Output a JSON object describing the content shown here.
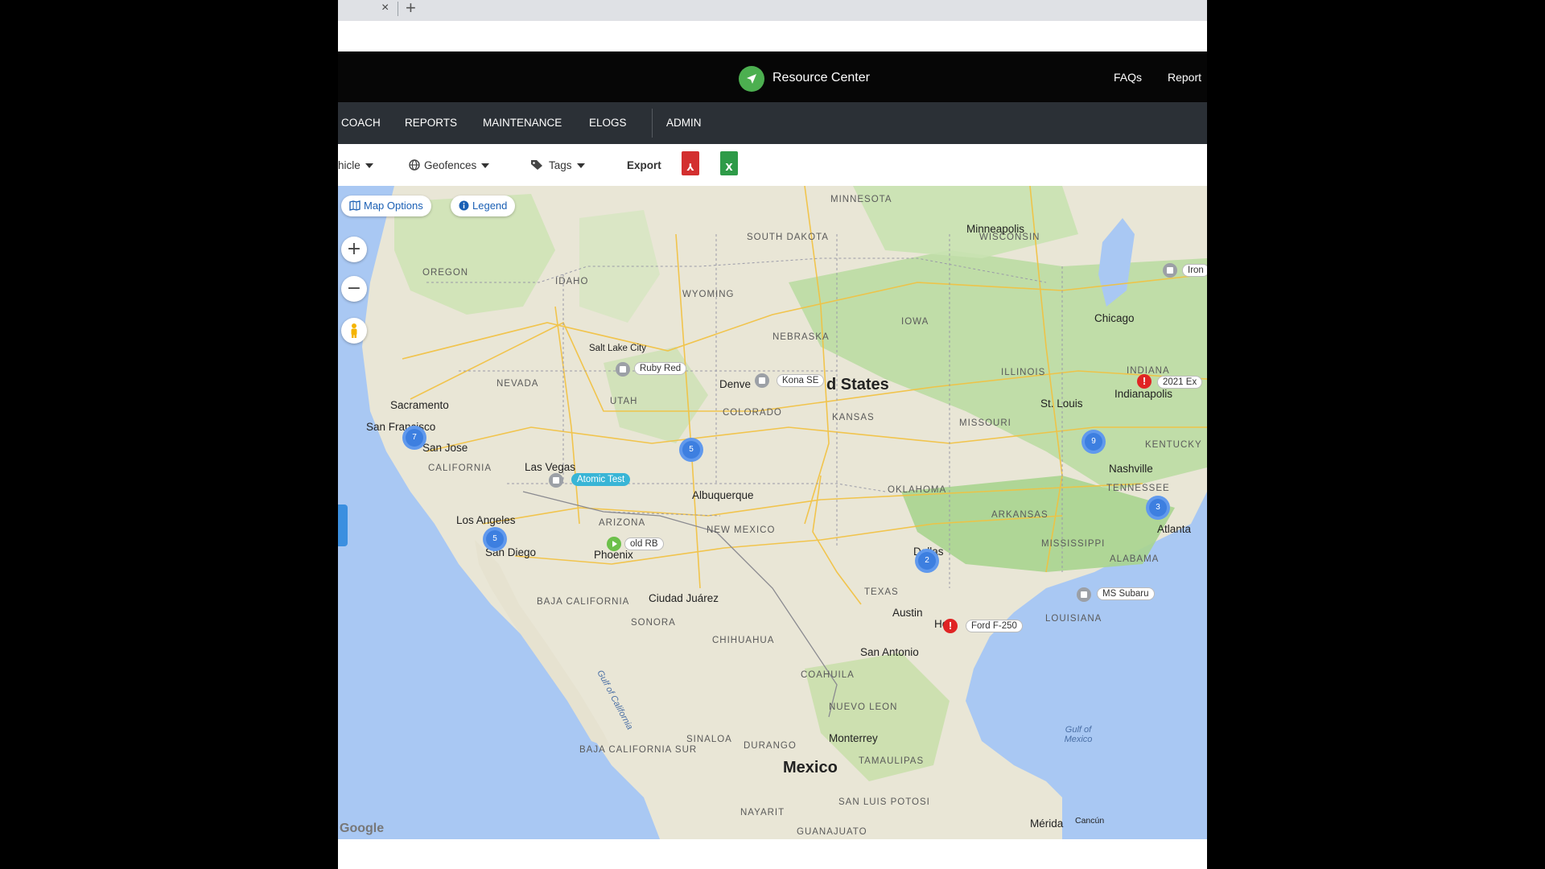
{
  "browser": {
    "close_glyph": "×",
    "new_tab_glyph": "+"
  },
  "header": {
    "app_name": "Resource Center",
    "links": [
      "FAQs",
      "Report"
    ]
  },
  "nav": {
    "items": [
      "COACH",
      "REPORTS",
      "MAINTENANCE",
      "ELOGS",
      "ADMIN"
    ]
  },
  "toolbar": {
    "vehicle_label": "hicle",
    "geofences_label": "Geofences",
    "tags_label": "Tags",
    "export_label": "Export",
    "pdf_glyph": "⅄",
    "excel_glyph": "X"
  },
  "map": {
    "options_label": "Map Options",
    "legend_label": "Legend",
    "zoom_in": "+",
    "zoom_out": "−",
    "attribution": "Google",
    "states": [
      "MINNESOTA",
      "SOUTH DAKOTA",
      "WISCONSIN",
      "OREGON",
      "IDAHO",
      "WYOMING",
      "IOWA",
      "NEBRASKA",
      "NEVADA",
      "UTAH",
      "COLORADO",
      "ILLINOIS",
      "INDIANA",
      "MISSOURI",
      "KANSAS",
      "CALIFORNIA",
      "KENTUCKY",
      "TENNESSEE",
      "ARIZONA",
      "NEW MEXICO",
      "OKLAHOMA",
      "ARKANSAS",
      "MISSISSIPPI",
      "ALABAMA",
      "TEXAS",
      "LOUISIANA",
      "BAJA CALIFORNIA",
      "SONORA",
      "CHIHUAHUA",
      "COAHUILA",
      "NUEVO LEON",
      "SINALOA",
      "DURANGO",
      "TAMAULIPAS",
      "BAJA CALIFORNIA SUR",
      "SAN LUIS POTOSI",
      "NAYARIT",
      "GUANAJUATO"
    ],
    "cities": [
      "Minneapolis",
      "Chicago",
      "Salt Lake City",
      "Denve",
      "St. Louis",
      "Indianapolis",
      "Sacramento",
      "San Francisco",
      "San Jose",
      "Las Vegas",
      "Nashville",
      "Albuquerque",
      "Los Angeles",
      "San Diego",
      "Phoenix",
      "Atlanta",
      "Dallas",
      "Ciudad Juárez",
      "Austin",
      "San Antonio",
      "Monterrey",
      "Mérida",
      "Cancún",
      "Ho"
    ],
    "country_labels": [
      "d States",
      "Mexico"
    ],
    "water_labels": [
      "Gulf of California",
      "Gulf of Mexico"
    ],
    "clusters": [
      "7",
      "5",
      "5",
      "9",
      "3",
      "2"
    ],
    "vehicles": [
      {
        "name": "Ruby Red",
        "status": "idle"
      },
      {
        "name": "Kona SE",
        "status": "idle"
      },
      {
        "name": "Atomic Test",
        "status": "idle",
        "selected": true
      },
      {
        "name": "old RB",
        "status": "moving"
      },
      {
        "name": "Ford F-250",
        "status": "alert"
      },
      {
        "name": "MS Subaru",
        "status": "idle"
      },
      {
        "name": "2021 Ex",
        "status": "alert"
      },
      {
        "name": "Iron",
        "status": "idle"
      }
    ]
  },
  "colors": {
    "header_bg": "#060606",
    "nav_bg": "#2b3036",
    "logo_green": "#4caf50",
    "cluster_blue": "#3d7fe0",
    "alert_red": "#e02424",
    "selected_label": "#39b5d6",
    "pdf_red": "#d32f2f",
    "excel_green": "#2e9b48"
  }
}
